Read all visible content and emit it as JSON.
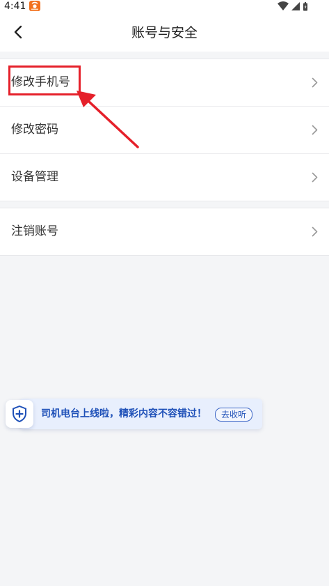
{
  "status_bar": {
    "time": "4:41",
    "app_icon": "taobao-app-icon",
    "icons": [
      "wifi-icon",
      "cellular-signal-icon",
      "battery-icon"
    ]
  },
  "header": {
    "title": "账号与安全",
    "back_icon": "back-arrow-icon"
  },
  "settings": {
    "group1": [
      {
        "label": "修改手机号",
        "icon": "chevron-right-icon"
      },
      {
        "label": "修改密码",
        "icon": "chevron-right-icon"
      },
      {
        "label": "设备管理",
        "icon": "chevron-right-icon"
      }
    ],
    "group2": [
      {
        "label": "注销账号",
        "icon": "chevron-right-icon"
      }
    ]
  },
  "annotation": {
    "color": "#e5202a",
    "target": "修改手机号"
  },
  "banner": {
    "icon": "shield-plus-icon",
    "text": "司机电台上线啦，精彩内容不容错过！",
    "button_label": "去收听"
  },
  "colors": {
    "background": "#f4f5f7",
    "surface": "#ffffff",
    "accent_blue": "#1e50b8",
    "annotation_red": "#e5202a"
  }
}
